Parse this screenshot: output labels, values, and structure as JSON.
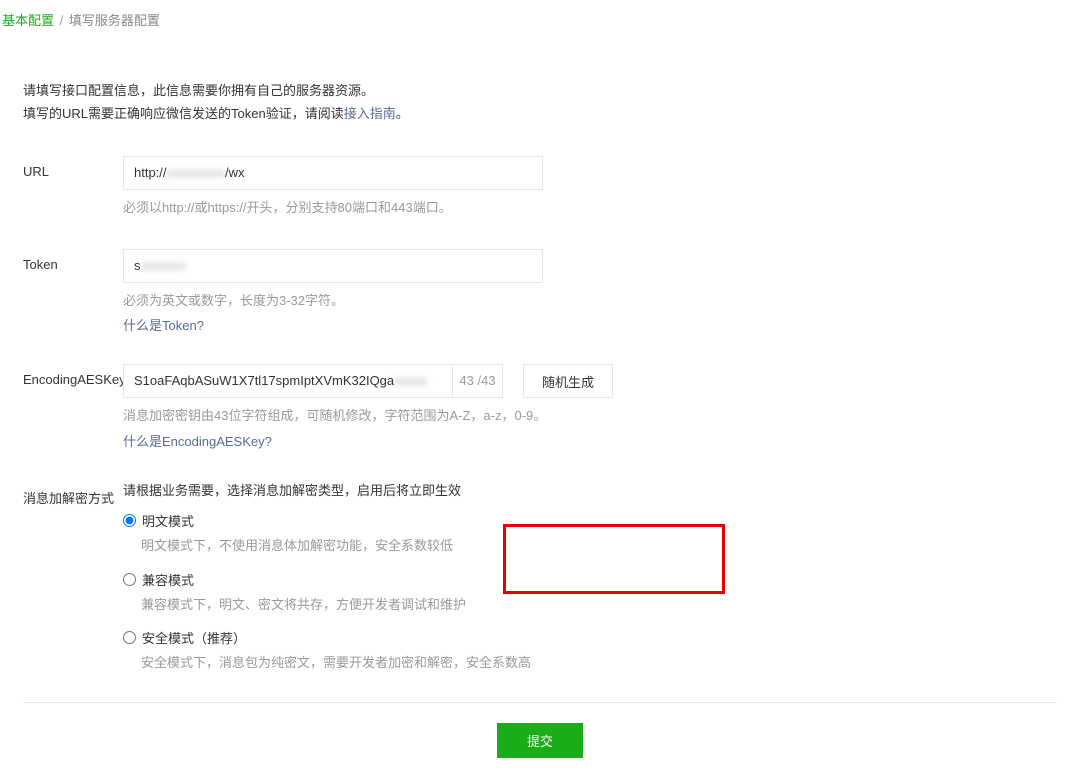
{
  "breadcrumb": {
    "root": "基本配置",
    "sep": "/",
    "current": "填写服务器配置"
  },
  "intro": {
    "line1": "请填写接口配置信息，此信息需要你拥有自己的服务器资源。",
    "line2_prefix": "填写的URL需要正确响应微信发送的Token验证，请阅读",
    "line2_link": "接入指南",
    "line2_suffix": "。"
  },
  "fields": {
    "url": {
      "label": "URL",
      "value_prefix": "http://",
      "value_mid": "xxxxxxxxx",
      "value_suffix": "/wx",
      "hint": "必须以http://或https://开头，分别支持80端口和443端口。"
    },
    "token": {
      "label": "Token",
      "value_prefix": "s",
      "value_mid": "xxxxxxx",
      "hint": "必须为英文或数字，长度为3-32字符。",
      "help_link": "什么是Token?"
    },
    "aeskey": {
      "label": "EncodingAESKey",
      "value": "S1oaFAqbASuW1X7tl17spmIptXVmK32IQga",
      "value_blur": "xxxxx",
      "count": "43 /43",
      "random_btn": "随机生成",
      "hint": "消息加密密钥由43位字符组成，可随机修改，字符范围为A-Z，a-z，0-9。",
      "help_link": "什么是EncodingAESKey?"
    },
    "encrypt": {
      "label": "消息加解密方式",
      "intro": "请根据业务需要，选择消息加解密类型，启用后将立即生效",
      "options": [
        {
          "label": "明文模式",
          "desc": "明文模式下，不使用消息体加解密功能，安全系数较低",
          "checked": true
        },
        {
          "label": "兼容模式",
          "desc": "兼容模式下，明文、密文将共存，方便开发者调试和维护",
          "checked": false
        },
        {
          "label": "安全模式（推荐）",
          "desc": "安全模式下，消息包为纯密文，需要开发者加密和解密，安全系数高",
          "checked": false
        }
      ]
    }
  },
  "submit_label": "提交"
}
